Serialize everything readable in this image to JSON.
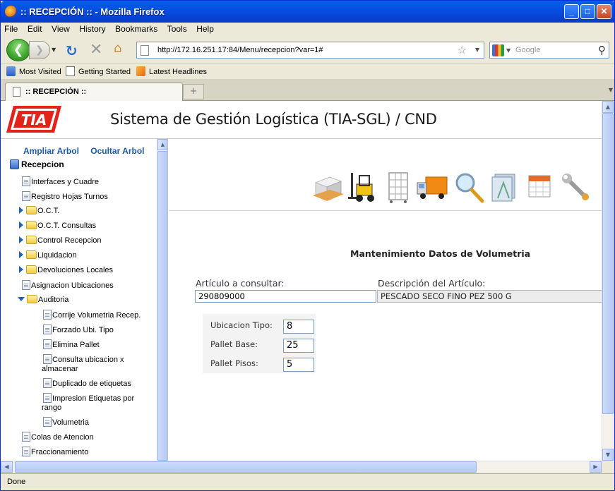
{
  "window": {
    "title": ":: RECEPCIÓN :: - Mozilla Firefox"
  },
  "menubar": [
    "File",
    "Edit",
    "View",
    "History",
    "Bookmarks",
    "Tools",
    "Help"
  ],
  "navbar": {
    "url": "http://172.16.251.17:84/Menu/recepcion?var=1#",
    "search_placeholder": "Google"
  },
  "bookmarks": [
    "Most Visited",
    "Getting Started",
    "Latest Headlines"
  ],
  "tabs": [
    {
      "label": ":: RECEPCIÓN ::"
    }
  ],
  "header": {
    "logo_text": "TIA",
    "title": "Sistema de Gestión Logística (TIA-SGL) / CND"
  },
  "tree": {
    "expand_label": "Ampliar Arbol",
    "hide_label": "Ocultar Arbol",
    "root": "Recepcion",
    "items": [
      "Interfaces y Cuadre",
      "Registro Hojas Turnos",
      "O.C.T.",
      "O.C.T. Consultas",
      "Control Recepcion",
      "Liquidacion",
      "Devoluciones Locales",
      "Asignacion Ubicaciones",
      "Auditoria",
      "Corrije Volumetria Recep.",
      "Forzado Ubi. Tipo",
      "Elimina Pallet",
      "Consulta ubicacion x almacenar",
      "Duplicado de etiquetas",
      "Impresion Etiquetas por rango",
      "Volumetria",
      "Colas de Atencion",
      "Fraccionamiento"
    ]
  },
  "toolbar_icons": [
    "pallet-icon",
    "forklift-icon",
    "rack-cart-icon",
    "truck-icon",
    "magnifier-icon",
    "folders-icon",
    "calendar-icon",
    "wrench-icon"
  ],
  "form": {
    "title": "Mantenimiento Datos de Volumetria",
    "article_label": "Artículo a consultar:",
    "article_value": "290809000",
    "description_label": "Descripción del Artículo:",
    "description_value": "PESCADO SECO FINO PEZ 500 G",
    "ubicacion_label": "Ubicacion Tipo:",
    "ubicacion_value": "8",
    "pallet_base_label": "Pallet Base:",
    "pallet_base_value": "25",
    "pallet_pisos_label": "Pallet Pisos:",
    "pallet_pisos_value": "5"
  },
  "status": {
    "text": "Done"
  },
  "colors": {
    "titlebar": "#0654e5",
    "link_blue": "#1d5aa3",
    "logo_red": "#e2231a",
    "tree_arrow": "#2261b7"
  }
}
